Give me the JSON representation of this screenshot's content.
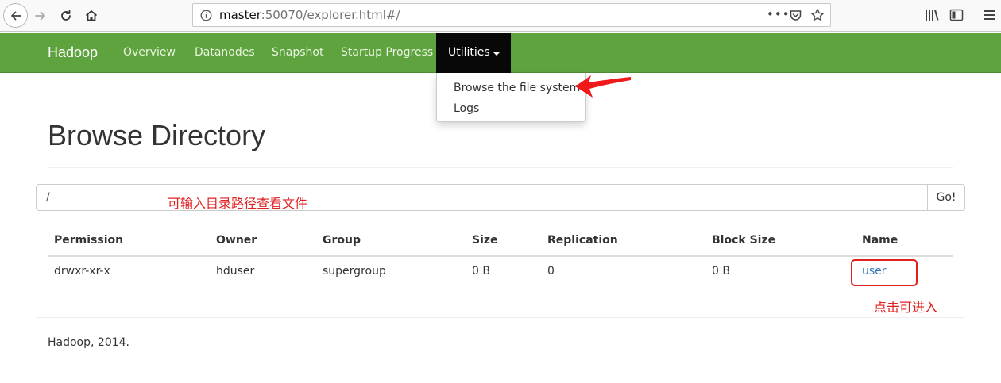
{
  "browser": {
    "url_host": "master",
    "url_rest": ":50070/explorer.html#/",
    "more_label": "•••"
  },
  "navbar": {
    "brand": "Hadoop",
    "items": [
      "Overview",
      "Datanodes",
      "Snapshot",
      "Startup Progress"
    ],
    "active": "Utilities",
    "accent": "#5fa33e"
  },
  "dropdown": {
    "items": [
      "Browse the file system",
      "Logs"
    ]
  },
  "page": {
    "title": "Browse Directory",
    "path_value": "/",
    "go_label": "Go!",
    "path_note": "可输入目录路径查看文件",
    "click_note": "点击可进入"
  },
  "table": {
    "headers": [
      "Permission",
      "Owner",
      "Group",
      "Size",
      "Replication",
      "Block Size",
      "Name"
    ],
    "rows": [
      [
        "drwxr-xr-x",
        "hduser",
        "supergroup",
        "0 B",
        "0",
        "0 B",
        "user"
      ]
    ]
  },
  "footer": {
    "text": "Hadoop, 2014."
  }
}
